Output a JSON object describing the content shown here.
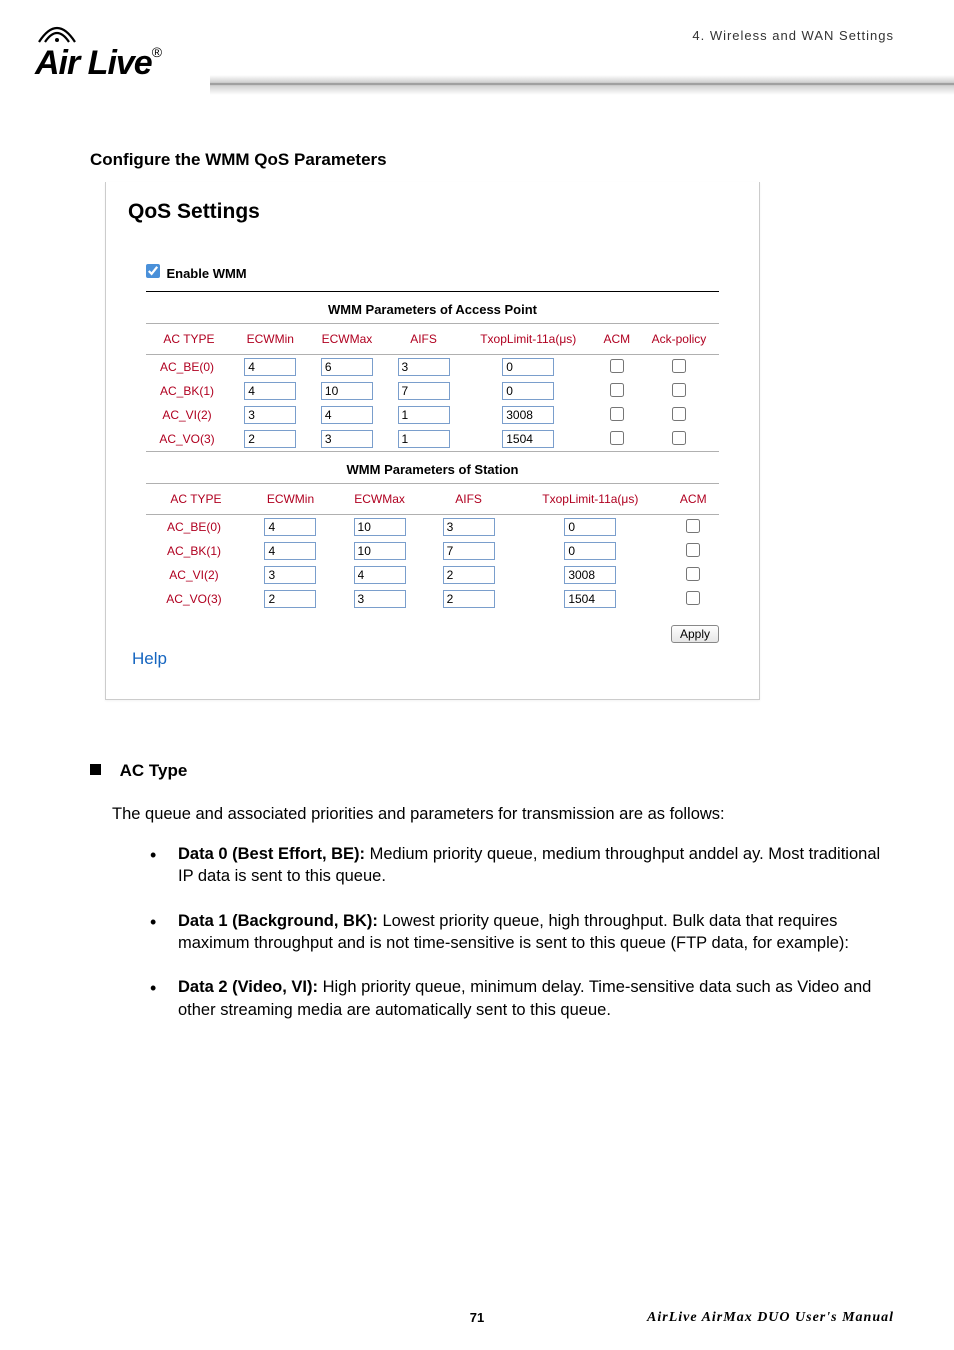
{
  "header": {
    "logo_text": "Air Live",
    "breadcrumb": "4.  Wireless  and  WAN  Settings"
  },
  "section_title": "Configure the WMM QoS Parameters",
  "qos": {
    "title": "QoS Settings",
    "enable_label": "Enable WMM",
    "enable_checked": true,
    "ap_caption": "WMM Parameters of Access Point",
    "sta_caption": "WMM Parameters of Station",
    "cols_ap": [
      "AC TYPE",
      "ECWMin",
      "ECWMax",
      "AIFS",
      "TxopLimit-11a(μs)",
      "ACM",
      "Ack-policy"
    ],
    "cols_sta": [
      "AC TYPE",
      "ECWMin",
      "ECWMax",
      "AIFS",
      "TxopLimit-11a(μs)",
      "ACM"
    ],
    "ap_rows": [
      {
        "type": "AC_BE(0)",
        "ecwmin": "4",
        "ecwmax": "6",
        "aifs": "3",
        "txop": "0",
        "acm": false,
        "ack": false
      },
      {
        "type": "AC_BK(1)",
        "ecwmin": "4",
        "ecwmax": "10",
        "aifs": "7",
        "txop": "0",
        "acm": false,
        "ack": false
      },
      {
        "type": "AC_VI(2)",
        "ecwmin": "3",
        "ecwmax": "4",
        "aifs": "1",
        "txop": "3008",
        "acm": false,
        "ack": false
      },
      {
        "type": "AC_VO(3)",
        "ecwmin": "2",
        "ecwmax": "3",
        "aifs": "1",
        "txop": "1504",
        "acm": false,
        "ack": false
      }
    ],
    "sta_rows": [
      {
        "type": "AC_BE(0)",
        "ecwmin": "4",
        "ecwmax": "10",
        "aifs": "3",
        "txop": "0",
        "acm": false
      },
      {
        "type": "AC_BK(1)",
        "ecwmin": "4",
        "ecwmax": "10",
        "aifs": "7",
        "txop": "0",
        "acm": false
      },
      {
        "type": "AC_VI(2)",
        "ecwmin": "3",
        "ecwmax": "4",
        "aifs": "2",
        "txop": "3008",
        "acm": false
      },
      {
        "type": "AC_VO(3)",
        "ecwmin": "2",
        "ecwmax": "3",
        "aifs": "2",
        "txop": "1504",
        "acm": false
      }
    ],
    "apply_label": "Apply",
    "help_label": "Help"
  },
  "body": {
    "ac_type": "AC Type",
    "intro": "The queue and associated priorities and parameters for transmission are as follows:",
    "items": [
      {
        "b": "Data 0 (Best Effort, BE):",
        "t": " Medium priority queue, medium throughput anddel ay. Most traditional IP data is sent to this queue."
      },
      {
        "b": "Data 1 (Background, BK):",
        "t": " Lowest priority queue, high throughput. Bulk data that requires maximum throughput and is not time-sensitive is sent to this queue (FTP data, for example):"
      },
      {
        "b": "Data 2 (Video, VI):",
        "t": " High priority queue, minimum delay. Time-sensitive data such as Video and other streaming media are automatically sent to this queue."
      }
    ]
  },
  "footer": {
    "page": "71",
    "manual": "AirLive  AirMax  DUO  User's  Manual"
  }
}
